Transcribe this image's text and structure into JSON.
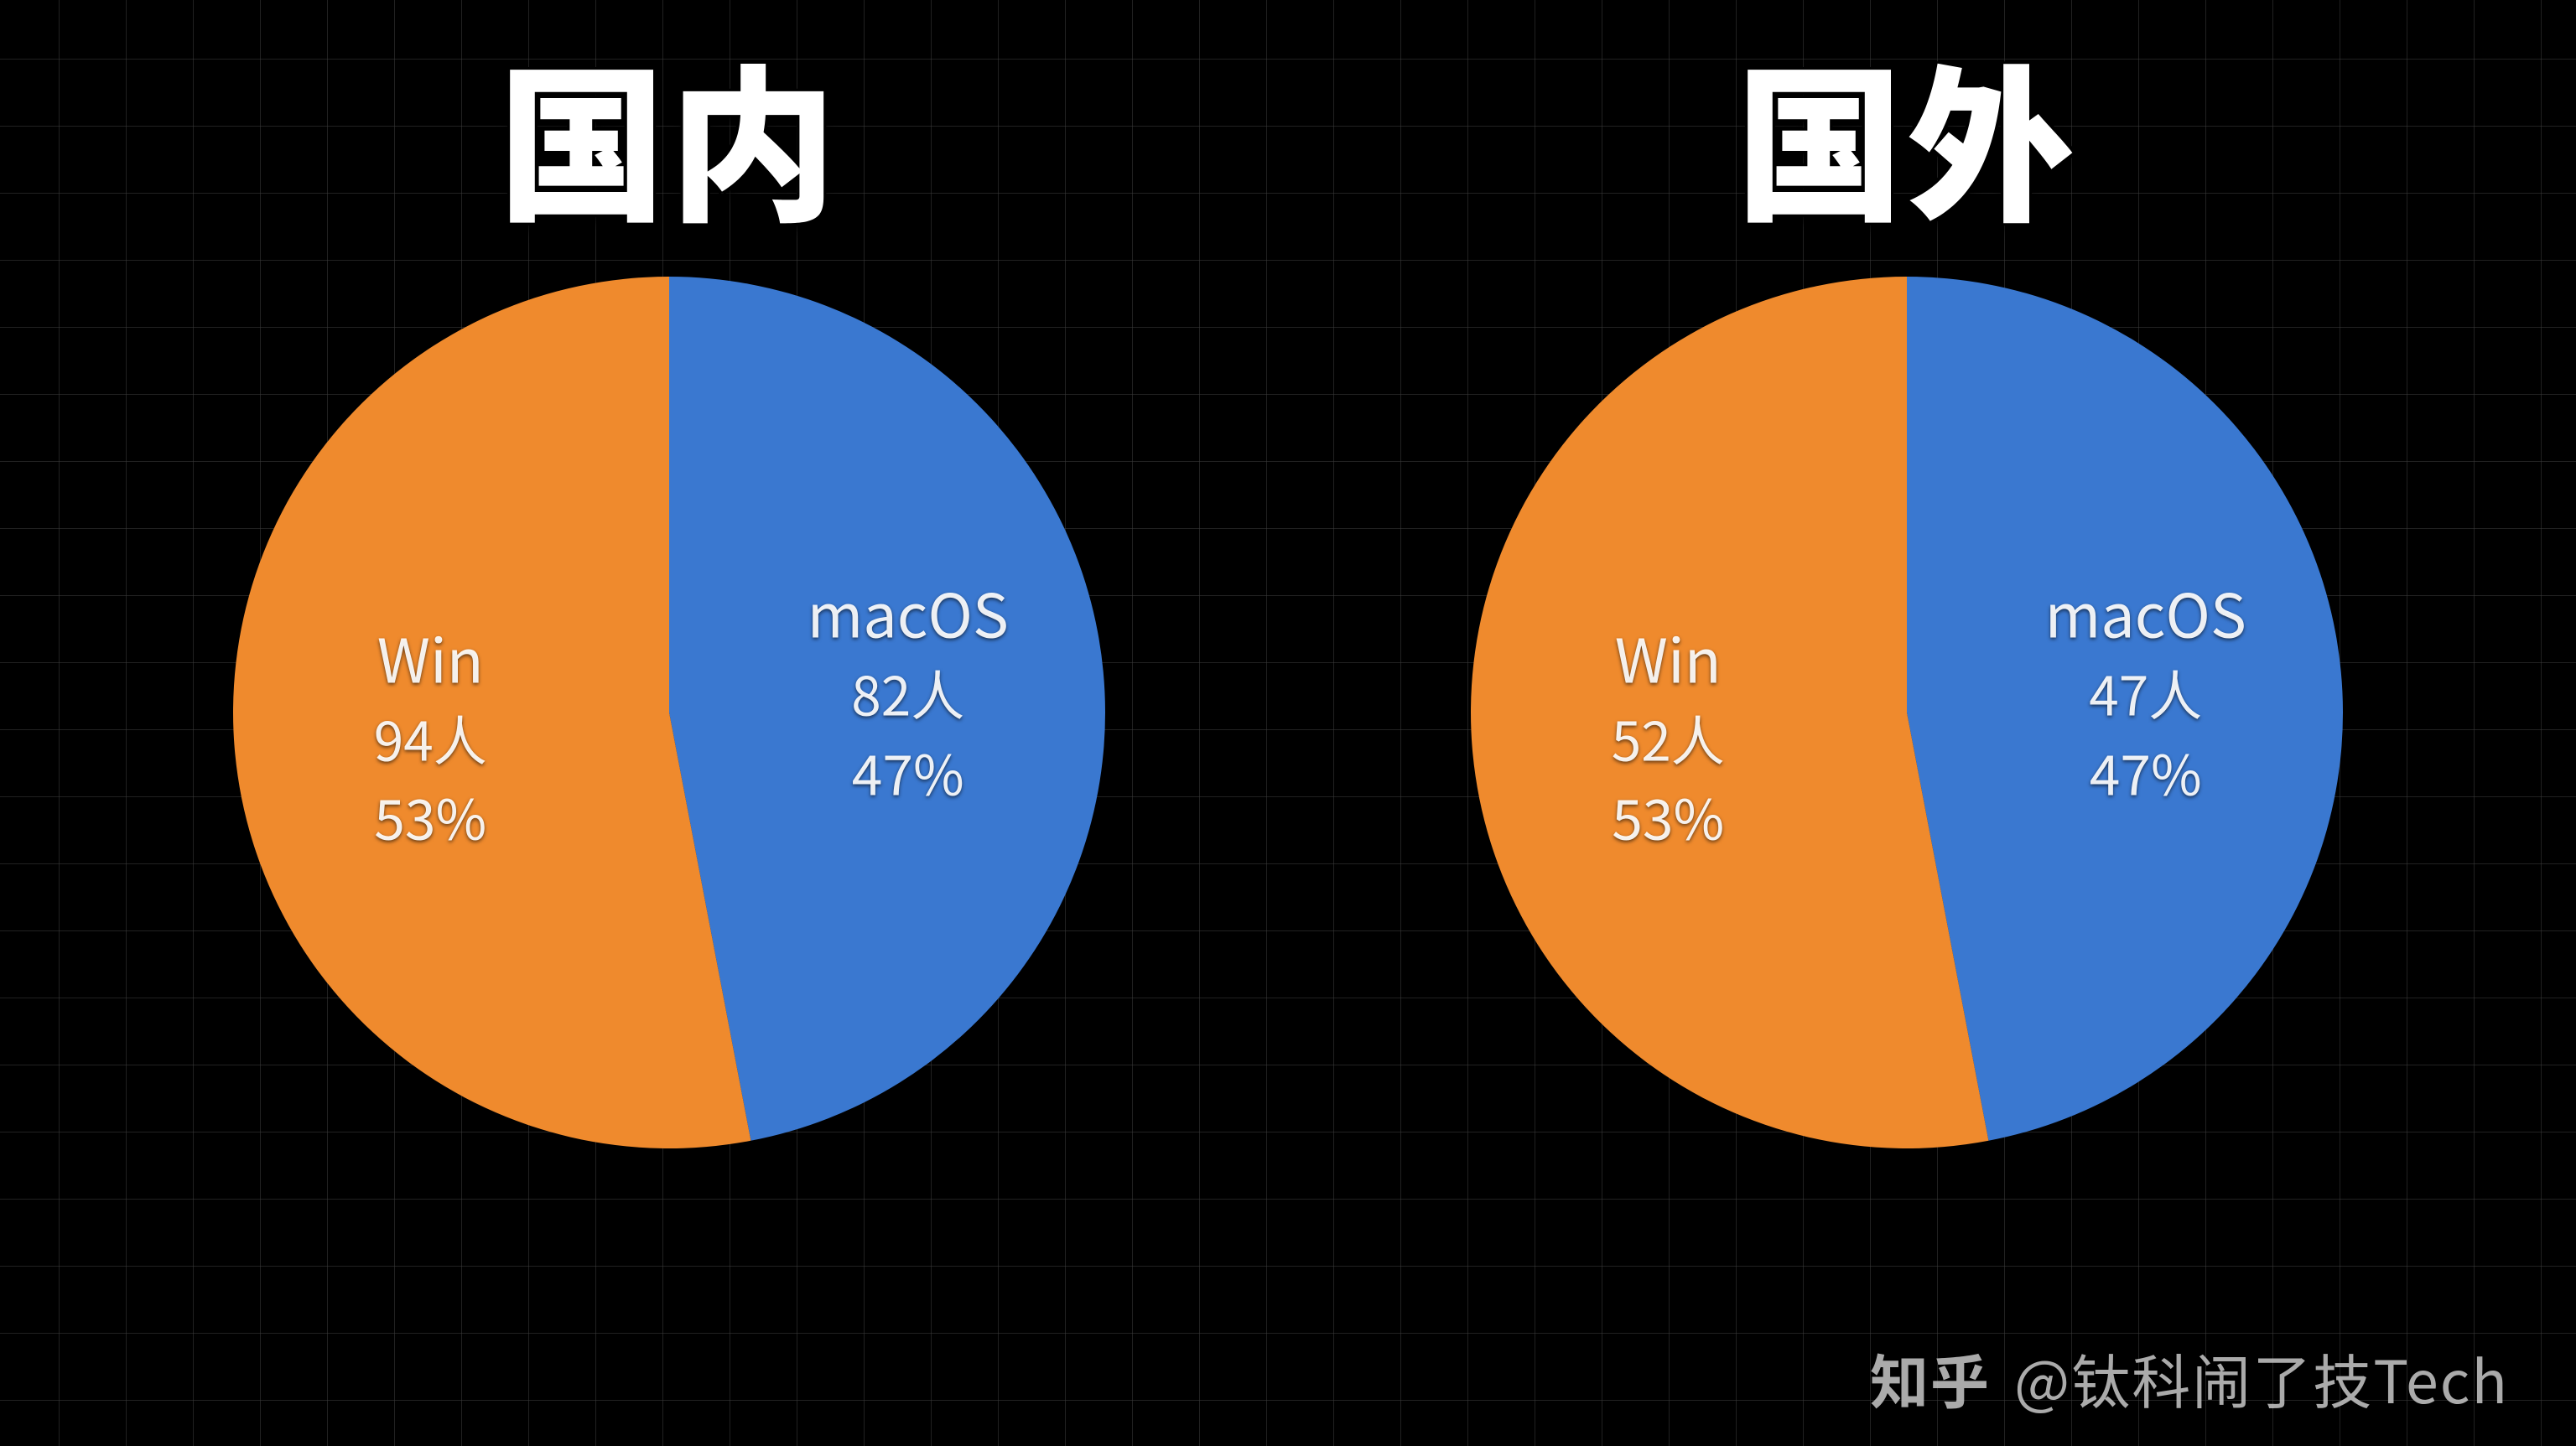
{
  "colors": {
    "macos": "#3a78d0",
    "win": "#ef8a2d"
  },
  "chart_data": [
    {
      "type": "pie",
      "title": "国内",
      "series": [
        {
          "name": "macOS",
          "count_label": "82人",
          "percent_label": "47%",
          "value": 47,
          "color_key": "macos"
        },
        {
          "name": "Win",
          "count_label": "94人",
          "percent_label": "53%",
          "value": 53,
          "color_key": "win"
        }
      ]
    },
    {
      "type": "pie",
      "title": "国外",
      "series": [
        {
          "name": "macOS",
          "count_label": "47人",
          "percent_label": "47%",
          "value": 47,
          "color_key": "macos"
        },
        {
          "name": "Win",
          "count_label": "52人",
          "percent_label": "53%",
          "value": 53,
          "color_key": "win"
        }
      ]
    }
  ],
  "watermark": {
    "logo": "知乎",
    "text": "@钛科闹了技Tech"
  }
}
